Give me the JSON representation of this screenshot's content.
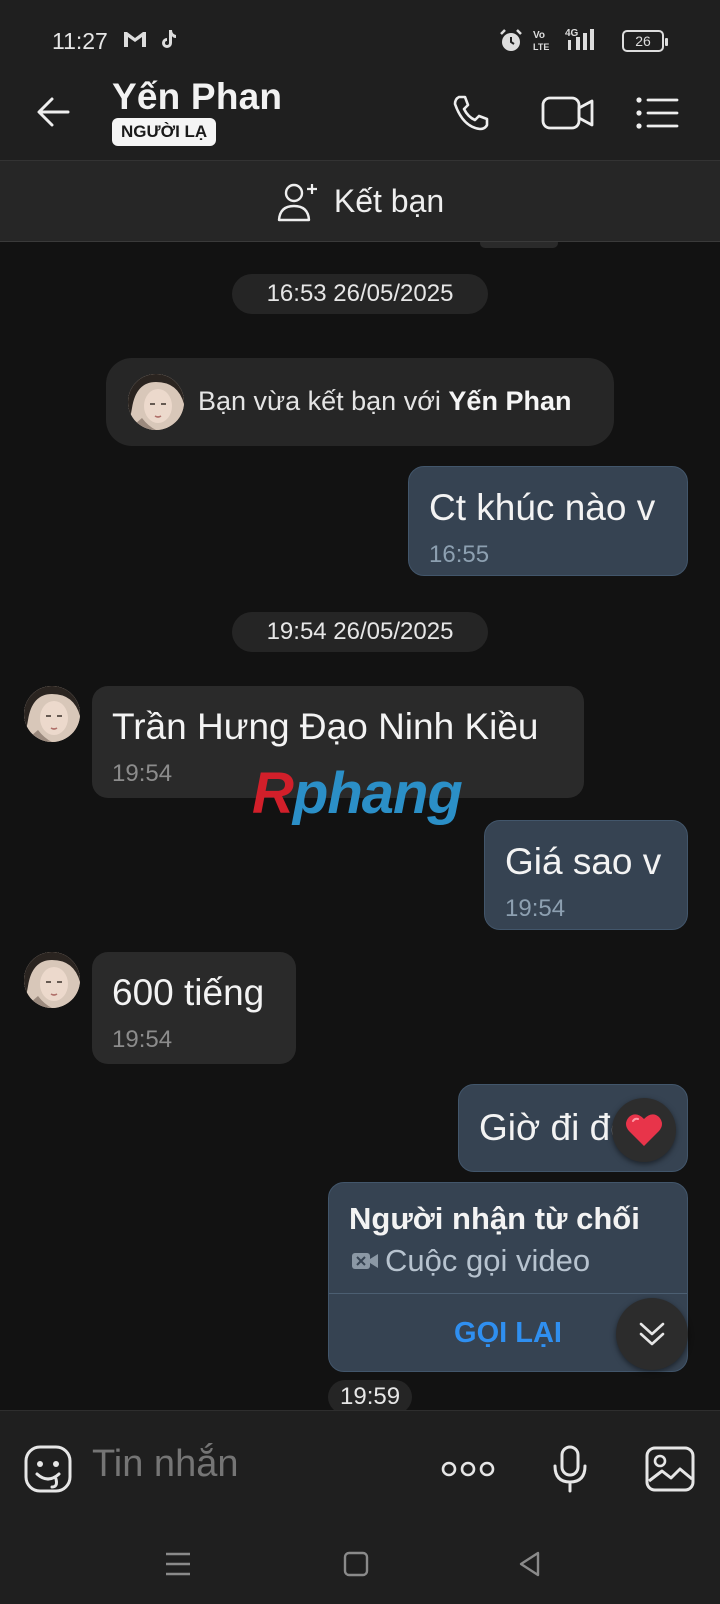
{
  "status_bar": {
    "time": "11:27",
    "battery": "26",
    "icons": [
      "gmail-icon",
      "tiktok-icon",
      "alarm-icon",
      "volte-icon",
      "4g-signal-icon",
      "battery-icon"
    ]
  },
  "header": {
    "contact_name": "Yến Phan",
    "badge": "NGƯỜI LẠ",
    "actions": [
      "voice-call-icon",
      "video-call-icon",
      "menu-list-icon"
    ]
  },
  "add_friend": {
    "label": "Kết bạn"
  },
  "chat": {
    "items": [
      {
        "type": "date",
        "text": "16:53 26/05/2025"
      },
      {
        "type": "system",
        "prefix": "Bạn vừa kết bạn với ",
        "name": "Yến Phan"
      },
      {
        "type": "out",
        "text": "Ct khúc nào v",
        "time": "16:55"
      },
      {
        "type": "date",
        "text": "19:54 26/05/2025"
      },
      {
        "type": "in",
        "text": "Trần Hưng Đạo Ninh Kiều",
        "time": "19:54"
      },
      {
        "type": "out",
        "text": "Giá sao v",
        "time": "19:54"
      },
      {
        "type": "in",
        "text": "600 tiếng",
        "time": "19:54"
      },
      {
        "type": "out",
        "text": "Giờ đi đc k"
      }
    ],
    "call": {
      "title": "Người nhận từ chối",
      "subtitle": "Cuộc gọi video",
      "action": "GỌI LẠI",
      "time": "19:59"
    },
    "watermark": {
      "first": "R",
      "rest": "phang"
    }
  },
  "composer": {
    "placeholder": "Tin nhắn"
  }
}
